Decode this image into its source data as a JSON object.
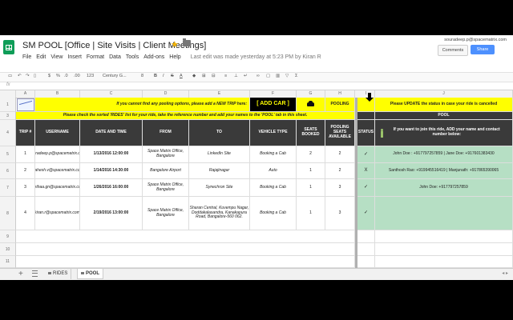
{
  "doc": {
    "title": "SM POOL [Office | Site Visits | Client Meetings]",
    "last_edit": "Last edit was made yesterday at 5:23 PM by Kiran R",
    "user_email": "souradeep.p@spacematrix.com",
    "comments_label": "Comments",
    "share_label": "Share"
  },
  "menu": [
    "File",
    "Edit",
    "View",
    "Insert",
    "Format",
    "Data",
    "Tools",
    "Add-ons",
    "Help"
  ],
  "toolbar": {
    "currency": "$",
    "percent": "%",
    "decimals": ".0",
    ".00": ".00",
    "format123": "123",
    "font": "Century G...",
    "size": "8",
    "bold": "B",
    "italic": "I",
    "strike": "S",
    "textcolor": "A"
  },
  "formula": {
    "fx": "fx"
  },
  "columns": [
    "A",
    "B",
    "C",
    "D",
    "E",
    "F",
    "G",
    "H",
    "I",
    "J"
  ],
  "row_numbers": [
    "1",
    "2",
    "3",
    "4",
    "5",
    "6",
    "7",
    "8",
    "9",
    "10",
    "11"
  ],
  "banner": {
    "row1_notice": "If you cannot find any pooling options, please add a NEW TRIP here:",
    "add_car": "[ ADD CAR ]",
    "pooling": "POOLING",
    "status_notice": "Please UPDATE the status in case your ride is cancelled",
    "row3_notice": "Please check the sorted 'RIDES' list for your ride, take the reference number and add your names to the 'POOL' tab in this sheet.",
    "pool_label": "POOL",
    "join_notice": "If you want to join this ride, ADD your name and contact number below:"
  },
  "table_headers": {
    "trip": "TRIP #",
    "username": "USERNAME",
    "datetime": "DATE AND TIME",
    "from": "FROM",
    "to": "TO",
    "vehicle": "VEHICLE TYPE",
    "seats_booked": "SEATS BOOKED",
    "seats_available": "POOLING SEATS AVAILABLE",
    "status": "STATUS"
  },
  "rows": [
    {
      "trip": "1",
      "username": "souradeep.p@spacematrix.com",
      "datetime": "1/13/2016 12:00:00",
      "from": "Space Matrix Office, Bangalore",
      "to": "LinkedIn Site",
      "vehicle": "Booking a Cab",
      "booked": "2",
      "available": "2",
      "status": "✓",
      "pool": "John Doe : +917797257859 | Jane Doe: +917601383430"
    },
    {
      "trip": "2",
      "username": "mahesh.v@spacematrix.com",
      "datetime": "1/14/2016 14:30:00",
      "from": "Bangalore Airport",
      "to": "Rajajinagar",
      "vehicle": "Auto",
      "booked": "1",
      "available": "2",
      "status": "X",
      "pool": "Santhosh Rao: +919945516419 | Manjunath: +917865390065"
    },
    {
      "trip": "3",
      "username": "reethaa.gn@spacematrix.com",
      "datetime": "1/26/2016 16:00:00",
      "from": "Space Matrix Office, Bangalore",
      "to": "Synechron Site",
      "vehicle": "Booking a Cab",
      "booked": "1",
      "available": "3",
      "status": "✓",
      "pool": "John Doe: +917797257859"
    },
    {
      "trip": "4",
      "username": "kiran.r@spacematrix.com",
      "datetime": "2/19/2016 13:00:00",
      "from": "Space Matrix Office, Bangalore",
      "to": "Sharan Central, Kuvempu Nagar, Doddakalasandra, Kanakapura Road, Bangalore-560 062.",
      "vehicle": "Booking a Cab",
      "booked": "1",
      "available": "3",
      "status": "✓",
      "pool": ""
    }
  ],
  "sheets": {
    "rides": "RIDES",
    "pool": "POOL"
  },
  "colors": {
    "yellow": "#ffff00",
    "header_dark": "#3a3a3a",
    "pool_green": "#b6dfc4",
    "sheets_green": "#0f9d58",
    "share_blue": "#4d90fe"
  },
  "icons": [
    "sheets-logo-icon",
    "star-icon",
    "folder-icon",
    "car-icon",
    "arrow-down-icon",
    "person-icon",
    "add-sheet-icon",
    "list-sheets-icon",
    "lock-icon"
  ]
}
